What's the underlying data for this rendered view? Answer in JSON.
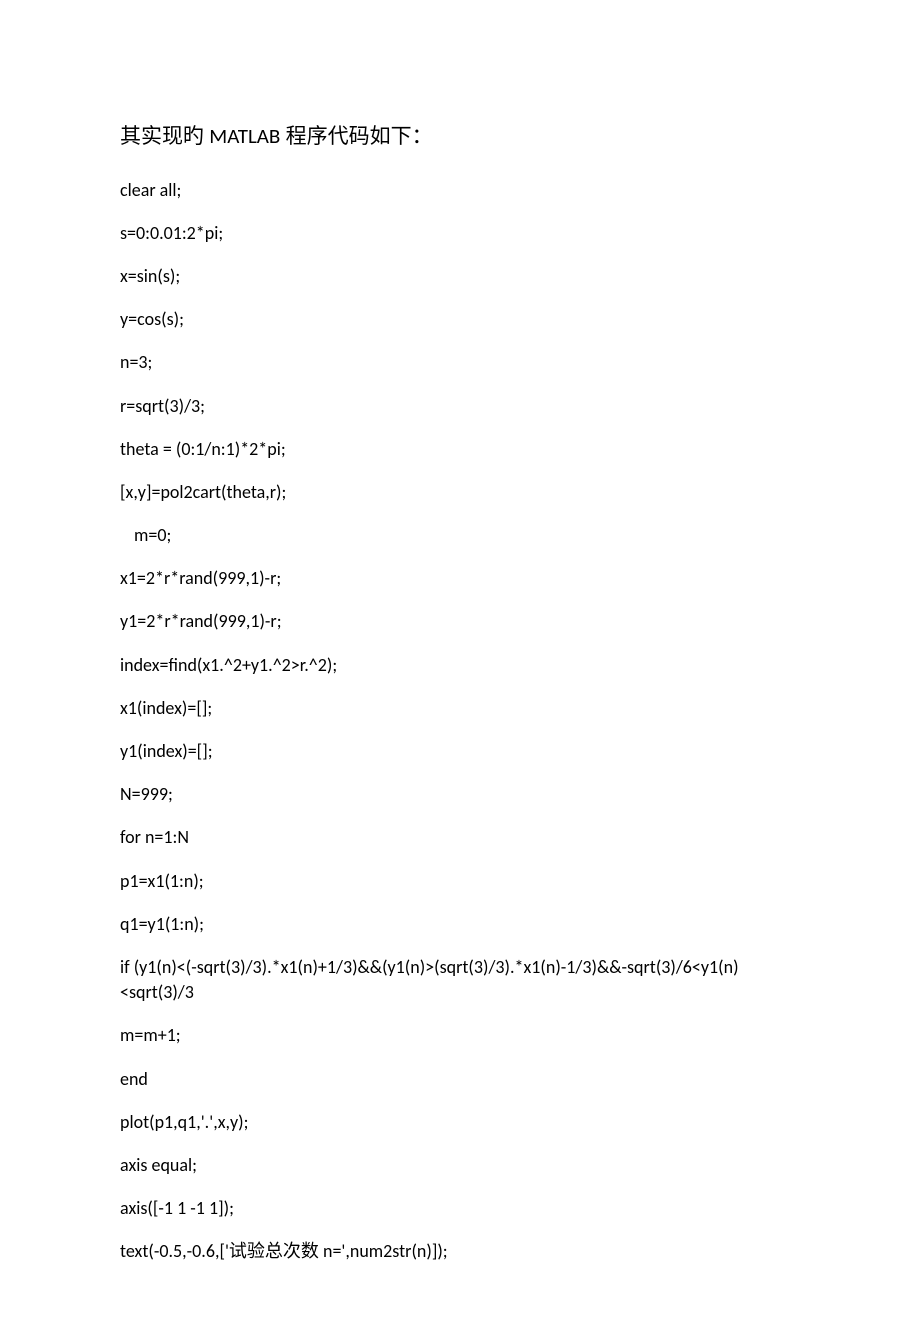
{
  "heading": {
    "prefix": "其实现旳 ",
    "latin": "MATLAB",
    "suffix": " 程序代码如下："
  },
  "code": {
    "lines": [
      "clear all;",
      "s=0:0.01:2*pi;",
      "x=sin(s);",
      "y=cos(s);",
      "n=3;",
      "r=sqrt(3)/3;",
      "theta = (0:1/n:1)*2*pi;",
      "[x,y]=pol2cart(theta,r);",
      "  m=0;",
      "x1=2*r*rand(999,1)-r;",
      "y1=2*r*rand(999,1)-r;",
      "index=find(x1.^2+y1.^2>r.^2);",
      "x1(index)=[];",
      "y1(index)=[];",
      "N=999;",
      "for n=1:N",
      "p1=x1(1:n);",
      "q1=y1(1:n);",
      "if (y1(n)<(-sqrt(3)/3).*x1(n)+1/3)&&(y1(n)>(sqrt(3)/3).*x1(n)-1/3)&&-sqrt(3)/6<y1(n)<sqrt(3)/3",
      "m=m+1;",
      "end",
      "plot(p1,q1,'.',x,y);",
      "axis equal;",
      "axis([-1 1 -1 1]);",
      "text(-0.5,-0.6,['试验总次数 n=',num2str(n)]);"
    ]
  }
}
